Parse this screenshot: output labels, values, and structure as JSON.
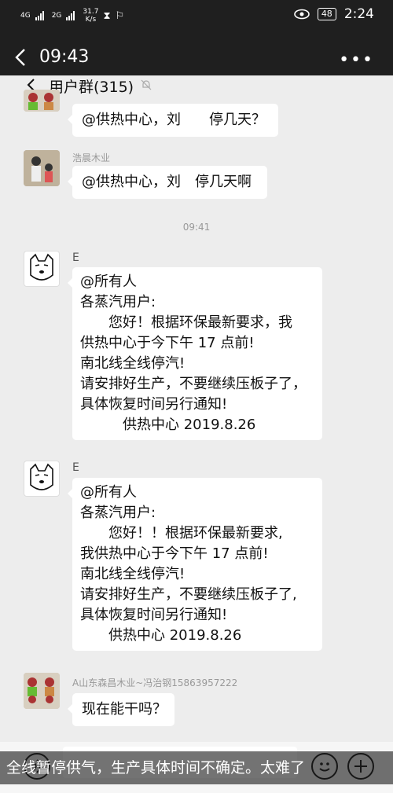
{
  "status_bar": {
    "network1": "4G",
    "network2": "2G",
    "speed_value": "31.7",
    "speed_unit": "K/s",
    "battery": "48",
    "clock": "2:24"
  },
  "outer_header": {
    "title": "09:43",
    "more_label": "•••"
  },
  "inner": {
    "chat_title": "用户群(315)",
    "messages": [
      {
        "sender": "",
        "lines": [
          "@供热中心，刘　　停几天？"
        ]
      },
      {
        "sender": "浩晨木业",
        "lines": [
          "@供热中心，刘　停几天啊"
        ]
      },
      {
        "sender": "E",
        "lines": [
          "@所有人",
          "各蒸汽用户:",
          "　　您好！根据环保最新要求，我",
          "供热中心于今下午 17 点前!",
          "南北线全线停汽!",
          "请安排好生产，不要继续压板子了，",
          "具体恢复时间另行通知!",
          "　　　供热中心 2019.8.26"
        ]
      },
      {
        "sender": "E",
        "lines": [
          "@所有人",
          "各蒸汽用户:",
          "　　您好！！根据环保最新要求,",
          "我供热中心于今下午 17 点前!",
          "南北线全线停汽!",
          "请安排好生产，不要继续压板子了,",
          "具体恢复时间另行通知!",
          "　　供热中心 2019.8.26"
        ]
      },
      {
        "sender": "A山东森昌木业~冯治钢15863957222",
        "lines": [
          "现在能干吗？"
        ]
      }
    ],
    "time_divider": "09:41"
  },
  "caption": "全线暂停供气，生产具体时间不确定。太难了",
  "colors": {
    "dark_bg": "#1f1f1f",
    "chat_bg": "#ededed",
    "bubble": "#ffffff",
    "meta_text": "#999999"
  }
}
